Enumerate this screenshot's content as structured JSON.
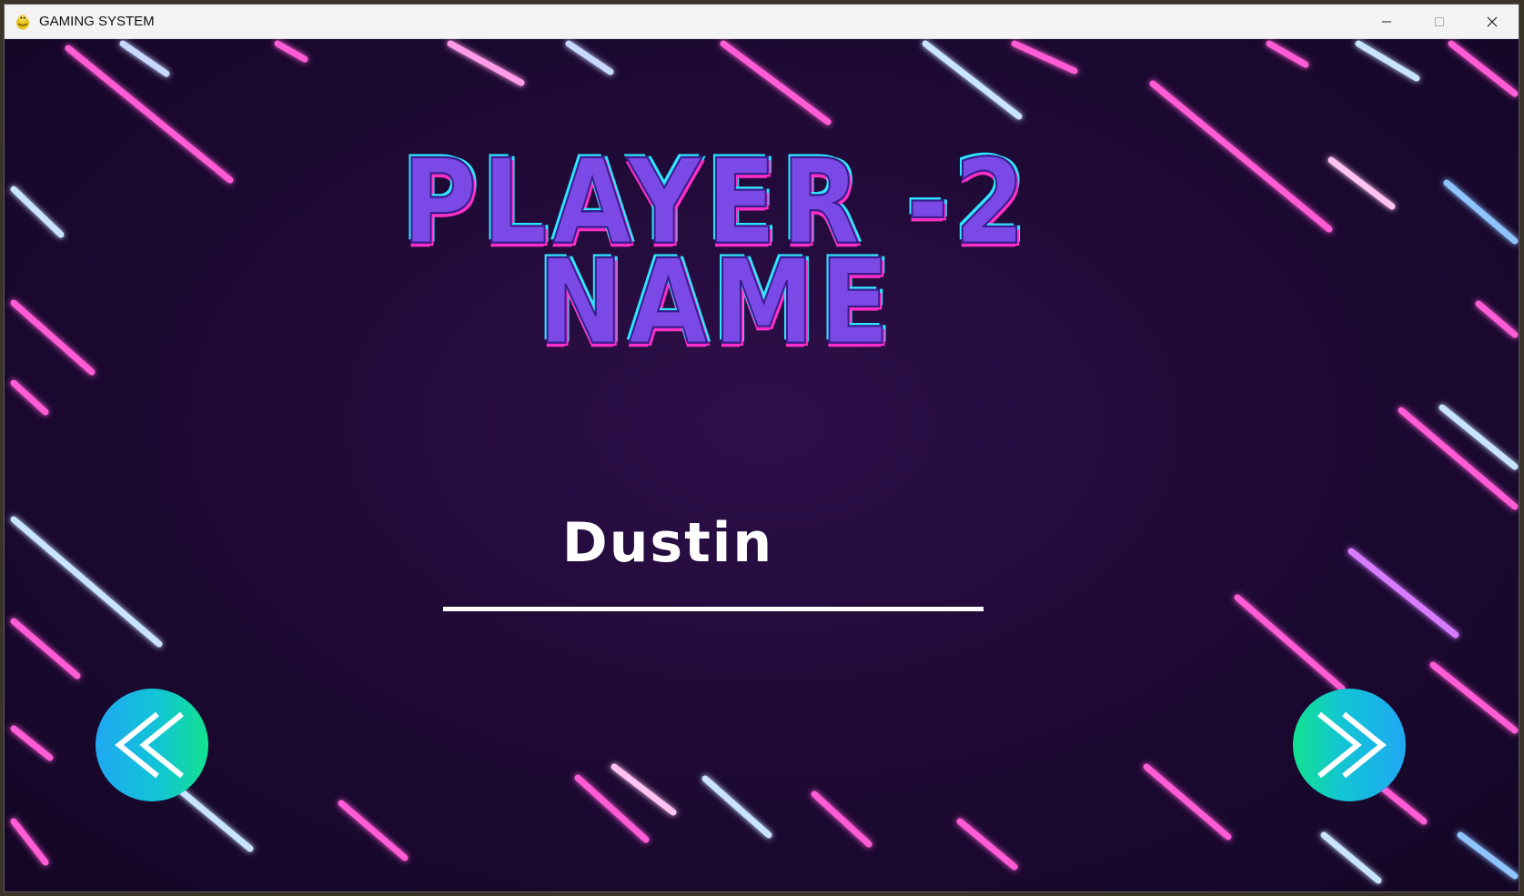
{
  "window": {
    "title": "GAMING SYSTEM",
    "app_icon": "pygame-snake-icon",
    "controls": [
      "minimize-icon",
      "maximize-icon",
      "close-icon"
    ]
  },
  "screen": {
    "heading_line1": "PLAYER -2",
    "heading_line2": "NAME",
    "name_input_value": "Dustin",
    "back_button_icon": "double-chevron-left-icon",
    "next_button_icon": "double-chevron-right-icon"
  },
  "colors": {
    "heading_fill": "#7b4ae6",
    "heading_outline_cyan": "#2ee6ff",
    "heading_outline_magenta": "#ff2fc8",
    "button_gradient_blue": "#1fa8f2",
    "button_gradient_green": "#12e28f",
    "background": "#1f0a36"
  }
}
